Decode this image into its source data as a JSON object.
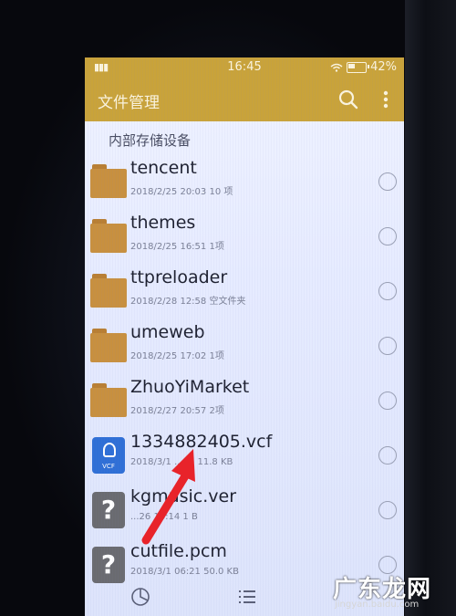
{
  "status_bar": {
    "time": "16:45",
    "battery": "42%",
    "signal_icon": "signal-bars-icon",
    "wifi_icon": "wifi-icon"
  },
  "app_bar": {
    "title": "文件管理",
    "search_icon": "search-icon",
    "more_icon": "more-vertical-icon"
  },
  "section": {
    "label": "内部存储设备"
  },
  "files": [
    {
      "name": "tencent",
      "meta": "2018/2/25 20:03  10 项",
      "type": "folder"
    },
    {
      "name": "themes",
      "meta": "2018/2/25 16:51  1项",
      "type": "folder"
    },
    {
      "name": "ttpreloader",
      "meta": "2018/2/28 12:58  空文件夹",
      "type": "folder"
    },
    {
      "name": "umeweb",
      "meta": "2018/2/25 17:02  1项",
      "type": "folder"
    },
    {
      "name": "ZhuoYiMarket",
      "meta": "2018/2/27 20:57  2项",
      "type": "folder"
    },
    {
      "name": "1334882405.vcf",
      "meta": "2018/3/1 ...43  11.8 KB",
      "type": "vcf",
      "icon_label": "VCF"
    },
    {
      "name": "kgmusic.ver",
      "meta": "...26 16:14  1 B",
      "type": "unknown"
    },
    {
      "name": "cutfile.pcm",
      "meta": "2018/3/1 06:21  50.0 KB",
      "type": "unknown"
    }
  ],
  "bottom_bar": {
    "storage_icon": "pie-chart-icon",
    "list_icon": "list-icon"
  },
  "colors": {
    "accent": "#c9a33a",
    "folder": "#c8903f",
    "arrow": "#e8232a",
    "vcf": "#2f6fd6"
  },
  "watermark": {
    "brand": "广东龙网",
    "site": "jingyan.baidu.com"
  }
}
